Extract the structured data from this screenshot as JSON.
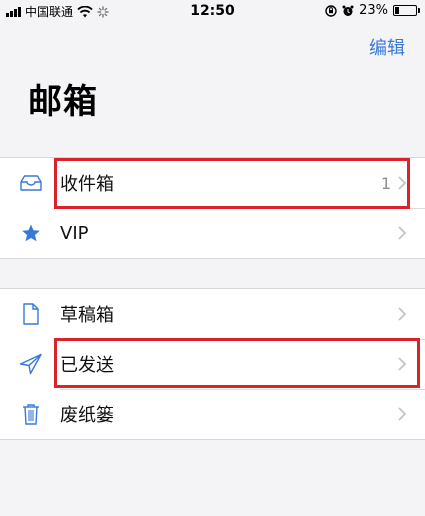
{
  "status_bar": {
    "carrier": "中国联通",
    "time": "12:50",
    "battery": "23%",
    "battery_level": 0.23
  },
  "nav": {
    "edit_label": "编辑",
    "title": "邮箱"
  },
  "mailboxes_group_1": [
    {
      "name": "inbox",
      "icon": "tray-icon",
      "label": "收件箱",
      "count": "1"
    },
    {
      "name": "vip",
      "icon": "star-icon",
      "label": "VIP",
      "count": ""
    }
  ],
  "mailboxes_group_2": [
    {
      "name": "drafts",
      "icon": "document-icon",
      "label": "草稿箱",
      "count": ""
    },
    {
      "name": "sent",
      "icon": "paper-plane-icon",
      "label": "已发送",
      "count": ""
    },
    {
      "name": "trash",
      "icon": "trash-icon",
      "label": "废纸篓",
      "count": ""
    }
  ],
  "colors": {
    "accent": "#3a78d8",
    "highlight": "#d8232a",
    "background": "#f4f4f6"
  }
}
